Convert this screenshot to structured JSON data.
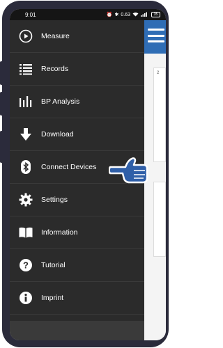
{
  "status_bar": {
    "time": "9:01",
    "network_speed": "0.63",
    "battery": "35"
  },
  "menu": {
    "items": [
      {
        "label": "Measure",
        "icon": "play-circle-icon"
      },
      {
        "label": "Records",
        "icon": "list-icon"
      },
      {
        "label": "BP Analysis",
        "icon": "bar-chart-icon"
      },
      {
        "label": "Download",
        "icon": "download-arrow-icon"
      },
      {
        "label": "Connect Devices",
        "icon": "bluetooth-icon"
      },
      {
        "label": "Settings",
        "icon": "gear-icon"
      },
      {
        "label": "Information",
        "icon": "book-icon"
      },
      {
        "label": "Tutorial",
        "icon": "question-icon"
      },
      {
        "label": "Imprint",
        "icon": "info-icon"
      }
    ]
  },
  "background": {
    "card_number": "2"
  },
  "colors": {
    "drawer": "#2b2b2b",
    "header": "#2f6db5",
    "frame": "#2b2b3b"
  }
}
